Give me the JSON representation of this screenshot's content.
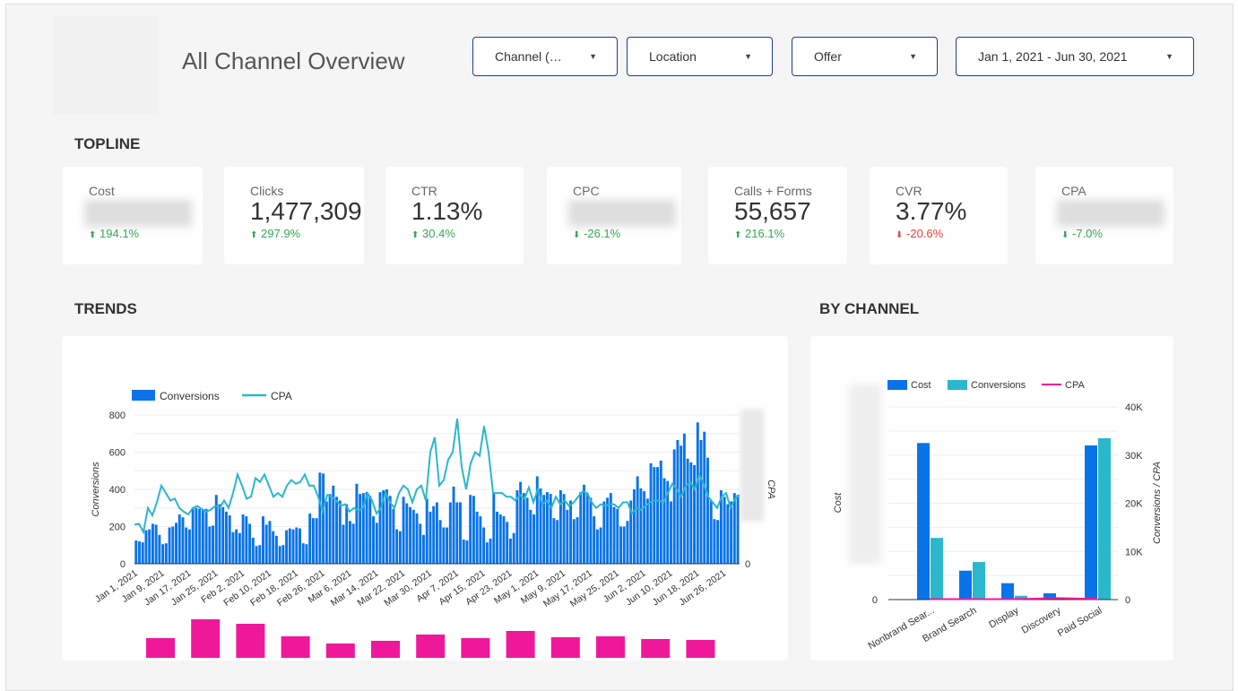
{
  "header": {
    "title": "All Channel Overview"
  },
  "filters": [
    {
      "label": "Channel (…"
    },
    {
      "label": "Location"
    },
    {
      "label": "Offer"
    },
    {
      "label": "Jan 1, 2021 - Jun 30, 2021"
    }
  ],
  "sections": {
    "topline": "TOPLINE",
    "trends": "TRENDS",
    "by_channel": "BY CHANNEL"
  },
  "colors": {
    "up": "#34a853",
    "down_good": "#34a853",
    "down_bad": "#ea4335",
    "conversions": "#0973ea",
    "cpa_line": "#2bb7cc",
    "cpa_pink": "#f0189a",
    "cost": "#0973ea",
    "conv_teal": "#2bb7cc"
  },
  "kpis": [
    {
      "label": "Cost",
      "value": null,
      "blurred": true,
      "change": "194.1%",
      "dir": "up",
      "status": "good"
    },
    {
      "label": "Clicks",
      "value": "1,477,309",
      "change": "297.9%",
      "dir": "up",
      "status": "good"
    },
    {
      "label": "CTR",
      "value": "1.13%",
      "change": "30.4%",
      "dir": "up",
      "status": "good"
    },
    {
      "label": "CPC",
      "value": null,
      "blurred": true,
      "change": "-26.1%",
      "dir": "down",
      "status": "good"
    },
    {
      "label": "Calls + Forms",
      "value": "55,657",
      "change": "216.1%",
      "dir": "up",
      "status": "good"
    },
    {
      "label": "CVR",
      "value": "3.77%",
      "change": "-20.6%",
      "dir": "down",
      "status": "bad"
    },
    {
      "label": "CPA",
      "value": null,
      "blurred": true,
      "change": "-7.0%",
      "dir": "down",
      "status": "good"
    }
  ],
  "chart_data": [
    {
      "type": "bar+line",
      "legend": [
        "Conversions",
        "CPA"
      ],
      "legend_position": "top-left",
      "ylabel": "Conversions",
      "y2label": "CPA",
      "ylim": [
        0,
        800
      ],
      "yticks": [
        "0",
        "200",
        "400",
        "600",
        "800"
      ],
      "y2ticks": [
        "0"
      ],
      "x_start": "Jan 1, 2021",
      "x_end": "Jun 30, 2021",
      "xticks": [
        "Jan 1, 2021",
        "Jan 9, 2021",
        "Jan 17, 2021",
        "Jan 25, 2021",
        "Feb 2, 2021",
        "Feb 10, 2021",
        "Feb 18, 2021",
        "Feb 26, 2021",
        "Mar 6, 2021",
        "Mar 14, 2021",
        "Mar 22, 2021",
        "Mar 30, 2021",
        "Apr 7, 2021",
        "Apr 15, 2021",
        "Apr 23, 2021",
        "May 1, 2021",
        "May 9, 2021",
        "May 17, 2021",
        "May 25, 2021",
        "Jun 2, 2021",
        "Jun 10, 2021",
        "Jun 18, 2021",
        "Jun 26, 2021"
      ],
      "conversions": [
        125,
        120,
        115,
        180,
        185,
        215,
        210,
        155,
        105,
        110,
        195,
        200,
        220,
        265,
        250,
        195,
        185,
        300,
        300,
        295,
        290,
        295,
        200,
        205,
        370,
        320,
        305,
        280,
        260,
        170,
        185,
        165,
        265,
        255,
        215,
        140,
        95,
        100,
        255,
        210,
        230,
        175,
        150,
        95,
        100,
        180,
        190,
        185,
        195,
        190,
        110,
        105,
        270,
        245,
        245,
        490,
        485,
        335,
        375,
        420,
        360,
        340,
        210,
        320,
        230,
        215,
        430,
        375,
        380,
        385,
        365,
        255,
        220,
        385,
        395,
        400,
        365,
        295,
        185,
        175,
        360,
        325,
        305,
        290,
        270,
        215,
        155,
        350,
        280,
        310,
        330,
        235,
        195,
        195,
        330,
        415,
        330,
        330,
        130,
        125,
        370,
        365,
        280,
        255,
        195,
        115,
        135,
        385,
        280,
        265,
        255,
        225,
        135,
        165,
        395,
        440,
        380,
        355,
        290,
        265,
        470,
        405,
        370,
        385,
        375,
        245,
        235,
        395,
        375,
        290,
        340,
        240,
        250,
        385,
        425,
        380,
        355,
        255,
        185,
        195,
        335,
        355,
        380,
        305,
        295,
        200,
        200,
        230,
        340,
        400,
        470,
        405,
        390,
        350,
        540,
        520,
        520,
        555,
        460,
        445,
        335,
        615,
        665,
        635,
        700,
        565,
        545,
        530,
        760,
        665,
        710,
        570,
        340,
        240,
        235,
        395,
        360,
        320,
        335,
        380,
        370
      ],
      "cpa_relative": [
        210,
        215,
        170,
        300,
        260,
        330,
        420,
        380,
        340,
        350,
        300,
        280,
        265,
        300,
        310,
        295,
        280,
        290,
        310,
        300,
        340,
        300,
        380,
        480,
        420,
        350,
        360,
        460,
        440,
        480,
        420,
        360,
        380,
        360,
        420,
        450,
        430,
        440,
        480,
        420,
        420,
        360,
        280,
        370,
        360,
        340,
        310,
        320,
        280,
        300,
        285,
        300,
        380,
        340,
        270,
        300,
        380,
        330,
        300,
        380,
        420,
        400,
        330,
        400,
        420,
        340,
        600,
        680,
        420,
        450,
        560,
        600,
        780,
        520,
        400,
        540,
        600,
        580,
        740,
        600,
        380,
        380,
        380,
        360,
        360,
        340,
        370,
        350,
        410,
        330,
        400,
        320,
        340,
        300,
        360,
        320,
        340,
        310,
        330,
        360,
        390,
        380,
        330,
        300,
        320,
        310,
        320,
        320,
        300,
        330,
        330,
        270,
        300,
        290,
        310,
        330,
        340,
        340,
        330,
        380,
        430,
        400,
        360,
        420,
        440,
        400,
        480,
        430,
        360,
        330,
        300,
        360,
        380,
        300,
        350,
        370
      ],
      "cpa_period_bars": [
        22,
        43,
        38,
        24,
        16,
        19,
        26,
        22,
        30,
        23,
        24,
        21,
        20
      ]
    },
    {
      "type": "bar+line",
      "legend": [
        "Cost",
        "Conversions",
        "CPA"
      ],
      "legend_position": "top",
      "ylabel": "Cost",
      "y2label": "Conversions / CPA",
      "y2lim": [
        0,
        40000
      ],
      "y2ticks": [
        "0",
        "10K",
        "20K",
        "30K",
        "40K"
      ],
      "yticks": [
        "0"
      ],
      "categories": [
        "Nonbrand Sear...",
        "Brand Search",
        "Display",
        "Discovery",
        "Paid Social"
      ],
      "series": [
        {
          "name": "Cost",
          "values_on_right_axis_scale": [
            32500,
            6000,
            3400,
            1300,
            32000
          ]
        },
        {
          "name": "Conversions",
          "values": [
            12800,
            7800,
            800,
            100,
            33500
          ]
        },
        {
          "name": "CPA",
          "values": [
            100,
            100,
            100,
            300,
            150
          ]
        }
      ]
    }
  ]
}
